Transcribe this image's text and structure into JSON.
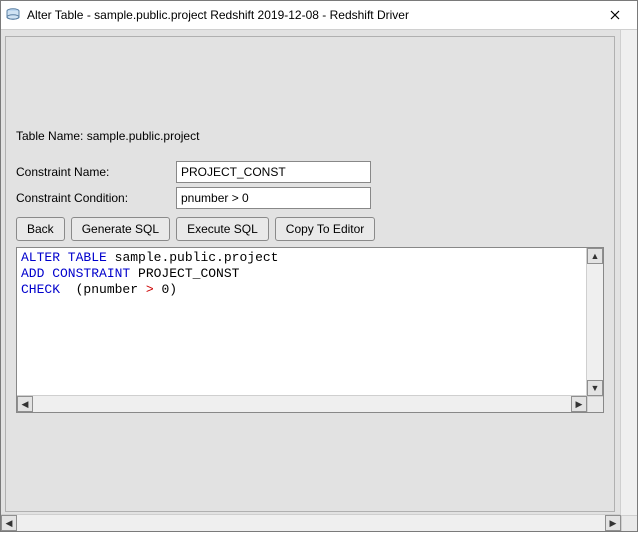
{
  "window": {
    "title": "Alter Table - sample.public.project Redshift 2019-12-08 - Redshift Driver"
  },
  "labels": {
    "table_name_prefix": "Table Name:",
    "constraint_name": "Constraint Name:",
    "constraint_condition": "Constraint Condition:"
  },
  "values": {
    "table_name": "sample.public.project",
    "constraint_name": "PROJECT_CONST",
    "constraint_condition": "pnumber > 0"
  },
  "buttons": {
    "back": "Back",
    "generate_sql": "Generate SQL",
    "execute_sql": "Execute SQL",
    "copy_to_editor": "Copy To Editor"
  },
  "sql": {
    "kw_alter_table": "ALTER TABLE",
    "table_ref": "sample.public.project",
    "kw_add_constraint": "ADD CONSTRAINT",
    "constraint_ref": "PROJECT_CONST",
    "kw_check": "CHECK",
    "paren_open": "(pnumber",
    "op_gt": ">",
    "paren_close": "0)"
  },
  "scroll_glyphs": {
    "up": "▲",
    "down": "▼",
    "left": "◀",
    "right": "▶"
  }
}
